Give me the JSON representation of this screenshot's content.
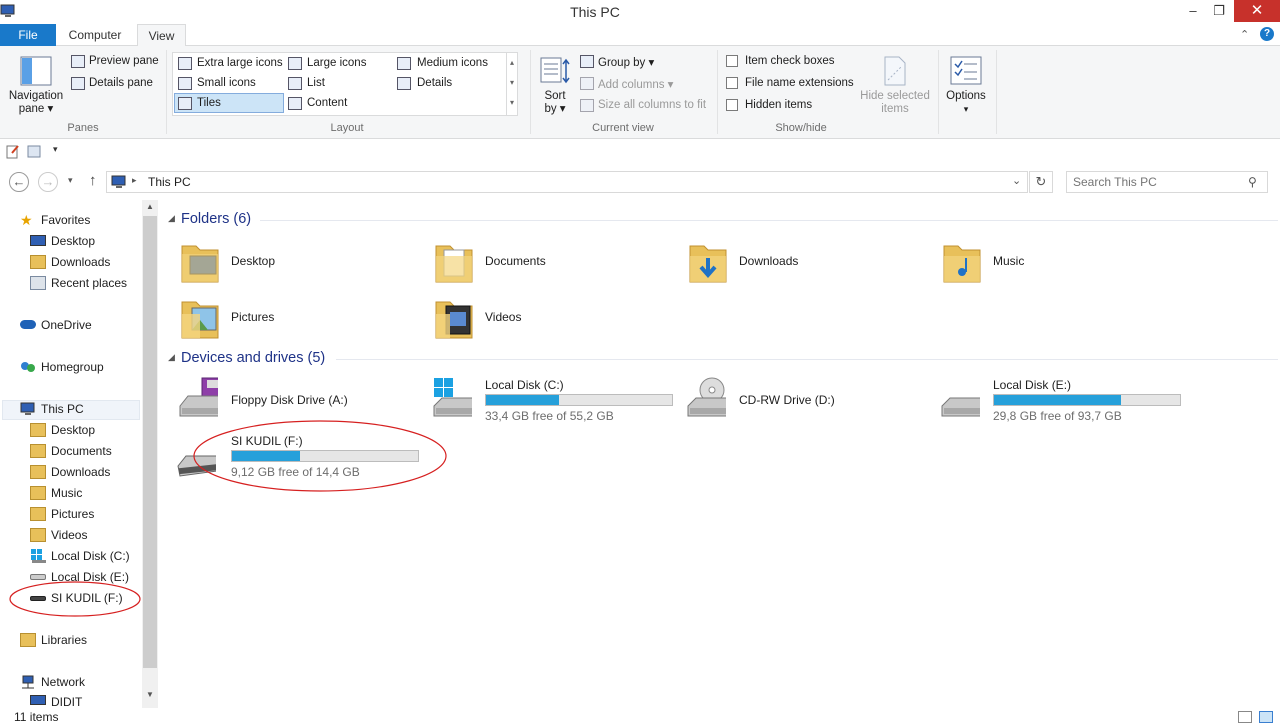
{
  "window": {
    "title": "This PC",
    "minimize": "–",
    "maximize": "❐",
    "close": "✕"
  },
  "tabs": {
    "file": "File",
    "computer": "Computer",
    "view": "View"
  },
  "ribbon": {
    "panes": {
      "label": "Panes",
      "navigation_pane_l1": "Navigation",
      "navigation_pane_l2": "pane ▾",
      "preview_pane": "Preview pane",
      "details_pane": "Details pane"
    },
    "layout": {
      "label": "Layout",
      "extra_large_icons": "Extra large icons",
      "large_icons": "Large icons",
      "medium_icons": "Medium icons",
      "small_icons": "Small icons",
      "list": "List",
      "details": "Details",
      "tiles": "Tiles",
      "content": "Content"
    },
    "current_view": {
      "label": "Current view",
      "sort_by_l1": "Sort",
      "sort_by_l2": "by ▾",
      "group_by": "Group by ▾",
      "add_columns": "Add columns ▾",
      "size_all_columns": "Size all columns to fit"
    },
    "show_hide": {
      "label": "Show/hide",
      "item_check_boxes": "Item check boxes",
      "file_name_extensions": "File name extensions",
      "hidden_items": "Hidden items",
      "hide_selected_l1": "Hide selected",
      "hide_selected_l2": "items"
    },
    "options": {
      "label_l1": "Options",
      "label_l2": "▾"
    }
  },
  "address": {
    "path": "This PC",
    "search_placeholder": "Search This PC"
  },
  "nav": {
    "favorites": "Favorites",
    "desktop": "Desktop",
    "downloads": "Downloads",
    "recent_places": "Recent places",
    "onedrive": "OneDrive",
    "homegroup": "Homegroup",
    "this_pc": "This PC",
    "pc_desktop": "Desktop",
    "pc_documents": "Documents",
    "pc_downloads": "Downloads",
    "pc_music": "Music",
    "pc_pictures": "Pictures",
    "pc_videos": "Videos",
    "local_disk_c": "Local Disk (C:)",
    "local_disk_e": "Local Disk (E:)",
    "si_kudil_f": "SI KUDIL (F:)",
    "libraries": "Libraries",
    "network": "Network",
    "didit": "DIDIT"
  },
  "content": {
    "folders_header": "Folders (6)",
    "folders": [
      {
        "name": "Desktop"
      },
      {
        "name": "Documents"
      },
      {
        "name": "Downloads"
      },
      {
        "name": "Music"
      },
      {
        "name": "Pictures"
      },
      {
        "name": "Videos"
      }
    ],
    "devices_header": "Devices and drives (5)",
    "drives": [
      {
        "name": "Floppy Disk Drive (A:)"
      },
      {
        "name": "Local Disk (C:)",
        "free": "33,4 GB free of 55,2 GB",
        "used_fraction": 0.395
      },
      {
        "name": "CD-RW Drive (D:)"
      },
      {
        "name": "Local Disk (E:)",
        "free": "29,8 GB free of 93,7 GB",
        "used_fraction": 0.682
      },
      {
        "name": "SI KUDIL (F:)",
        "free": "9,12 GB free of 14,4 GB",
        "used_fraction": 0.367
      }
    ]
  },
  "status": {
    "items": "11 items"
  },
  "colors": {
    "accent": "#1979ca",
    "bar_fill": "#26a0da",
    "annotation": "#d62020"
  }
}
